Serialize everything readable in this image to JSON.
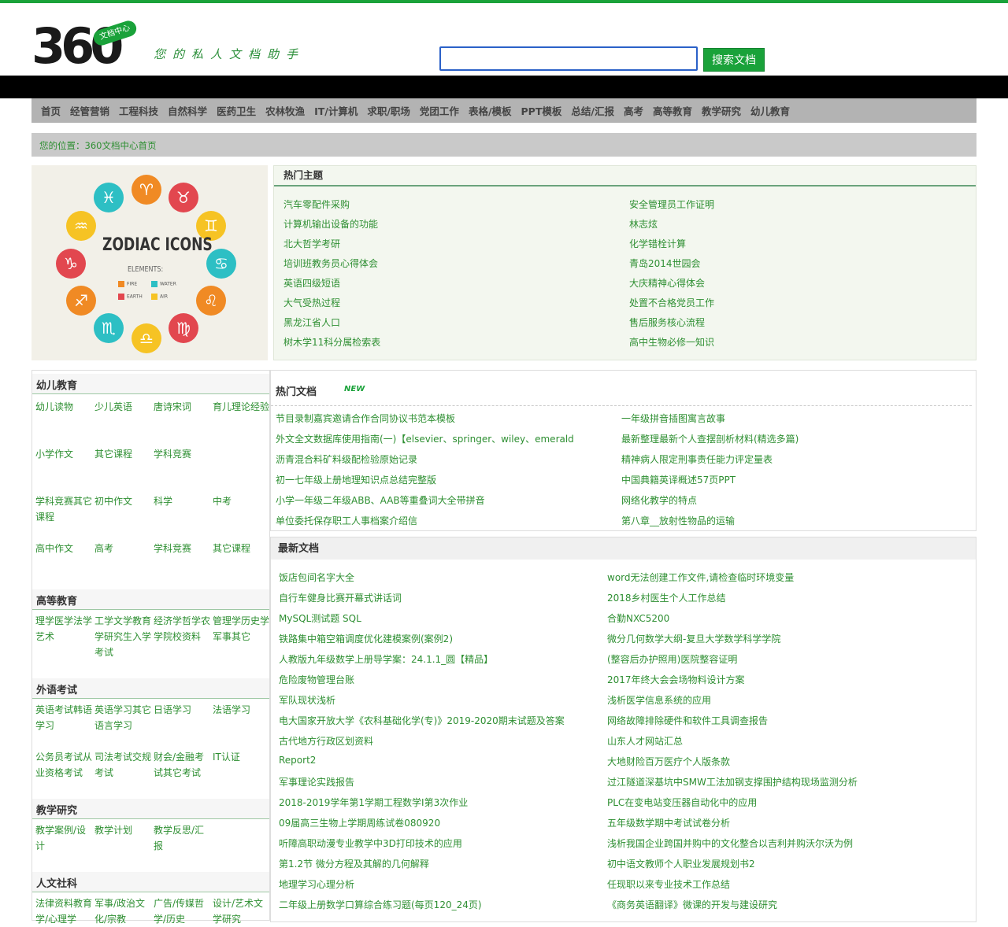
{
  "header": {
    "logo_number": "360",
    "logo_badge": "文档中心",
    "slogan": "您的私人文档助手",
    "search_value": "",
    "search_button": "搜索文档"
  },
  "nav": [
    "首页",
    "经管营销",
    "工程科技",
    "自然科学",
    "医药卫生",
    "农林牧渔",
    "IT/计算机",
    "求职/职场",
    "党团工作",
    "表格/模板",
    "PPT模板",
    "总结/汇报",
    "高考",
    "高等教育",
    "教学研究",
    "幼儿教育"
  ],
  "breadcrumb": "您的位置：360文档中心首页",
  "banner": {
    "title": "ZODIAC ICONS",
    "subtitle": "ELEMENTS:",
    "legend": [
      {
        "label": "FIRE",
        "color": "#f08a24"
      },
      {
        "label": "WATER",
        "color": "#2dbfc4"
      },
      {
        "label": "EARTH",
        "color": "#e2474f"
      },
      {
        "label": "AIR",
        "color": "#f6c324"
      }
    ]
  },
  "hot_topics": {
    "title": "热门主题",
    "left": [
      "汽车零配件采购",
      "计算机输出设备的功能",
      "北大哲学考研",
      "培训班教务员心得体会",
      "英语四级短语",
      "大气受热过程",
      "黑龙江省人口",
      "树木学11科分属检索表"
    ],
    "right": [
      "安全管理员工作证明",
      "林志炫",
      "化学错栓计算",
      "青岛2014世园会",
      "大庆精神心得体会",
      "处置不合格党员工作",
      "售后服务核心流程",
      "高中生物必修一知识"
    ]
  },
  "sidebar": {
    "sections": [
      {
        "title": "幼儿教育",
        "rows": [
          [
            "幼儿读物",
            "少儿英语",
            "唐诗宋词",
            "育儿理论经验"
          ],
          [
            "小学作文",
            "其它课程",
            "学科竞赛",
            ""
          ],
          [
            "学科竞赛其它课程",
            "初中作文",
            "科学",
            "中考"
          ],
          [
            "高中作文",
            "高考",
            "学科竞赛",
            "其它课程"
          ]
        ]
      },
      {
        "title": "高等教育",
        "rows": [
          [
            "理学医学法学艺术",
            "工学文学教育学研究生入学考试",
            "经济学哲学农学院校资料",
            "管理学历史学军事其它"
          ]
        ]
      },
      {
        "title": "外语考试",
        "rows": [
          [
            "英语考试韩语学习",
            "英语学习其它语言学习",
            "日语学习",
            "法语学习"
          ],
          [
            "公务员考试从业资格考试",
            "司法考试交规考试",
            "财会/金融考试其它考试",
            "IT认证"
          ]
        ]
      },
      {
        "title": "教学研究",
        "rows": [
          [
            "教学案例/设计",
            "教学计划",
            "教学反思/汇报",
            ""
          ]
        ]
      },
      {
        "title": "人文社科",
        "rows": [
          [
            "法律资料教育学/心理学",
            "军事/政治文化/宗教",
            "广告/传媒哲学/历史",
            "设计/艺术文学研究"
          ]
        ]
      }
    ]
  },
  "hot_docs": {
    "title": "热门文档",
    "badge": "NEW",
    "left": [
      "节目录制嘉宾邀请合作合同协议书范本模板",
      "外文全文数据库使用指南(一)【elsevier、springer、wiley、emerald",
      "沥青混合料矿料级配检验原始记录",
      "初一七年级上册地理知识点总结完整版",
      "小学一年级二年级ABB、AAB等重叠词大全带拼音",
      "单位委托保存职工人事档案介绍信"
    ],
    "right": [
      "一年级拼音插图寓言故事",
      "最新整理最新个人查摆剖析材料(精选多篇)",
      "精神病人限定刑事责任能力评定量表",
      "中国典籍英译概述57页PPT",
      "网络化教学的特点",
      "第八章__放射性物品的运输"
    ]
  },
  "new_docs": {
    "title": "最新文档",
    "left": [
      "饭店包间名字大全",
      "自行车健身比赛开幕式讲话词",
      "MySQL测试题 SQL",
      "铁路集中箱空箱调度优化建模案例(案例2)",
      "人教版九年级数学上册导学案：24.1.1_圆【精品】",
      "危险废物管理台账",
      "军队现状浅析",
      "电大国家开放大学《农科基础化学(专)》2019-2020期末试题及答案",
      "古代地方行政区划资料",
      "Report2",
      "军事理论实践报告",
      "2018-2019学年第1学期工程数学I第3次作业",
      "09届高三生物上学期周练试卷080920",
      "听障高职动漫专业教学中3D打印技术的应用",
      "第1.2节 微分方程及其解的几何解释",
      "地理学习心理分析",
      "二年级上册数学口算综合练习题(每页120_24页)"
    ],
    "right": [
      "word无法创建工作文件,请检查临时环境变量",
      "2018乡村医生个人工作总结",
      "合勤NXC5200",
      "微分几何数学大纲-复旦大学数学科学学院",
      "(整容后办护照用)医院整容证明",
      "2017年终大会会场物料设计方案",
      "浅析医学信息系统的应用",
      "网络故障排除硬件和软件工具调查报告",
      "山东人才网站汇总",
      "大地财险百万医疗个人版条款",
      "过江隧道深基坑中SMW工法加钢支撑围护结构现场监测分析",
      "PLC在变电站变压器自动化中的应用",
      "五年级数学期中考试试卷分析",
      "浅析我国企业跨国并购中的文化整合以吉利并购沃尔沃为例",
      "初中语文教师个人职业发展规划书2",
      "任现职以来专业技术工作总结",
      "《商务英语翻译》微课的开发与建设研究"
    ]
  }
}
